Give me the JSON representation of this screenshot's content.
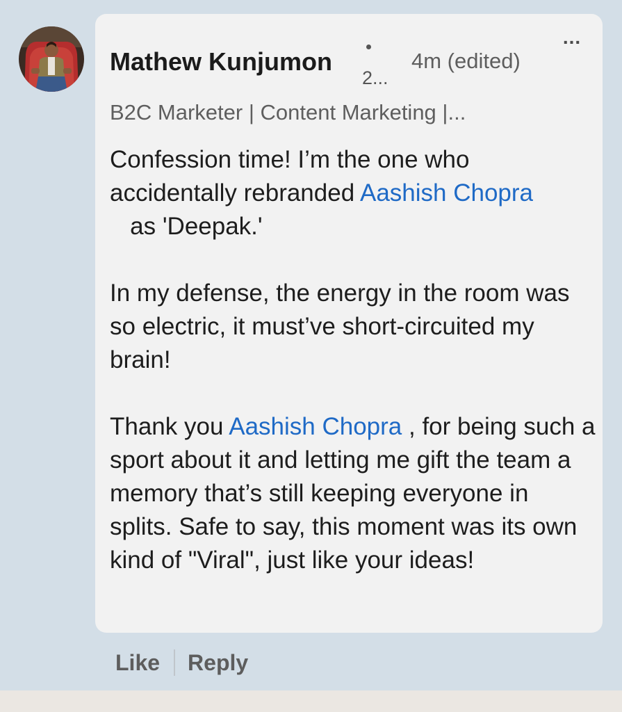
{
  "comment": {
    "author": {
      "name": "Mathew Kunjumon",
      "degree": "2...",
      "headline": "B2C Marketer | Content Marketing |..."
    },
    "timestamp": "4m (edited)",
    "more_label": "...",
    "body": {
      "p1_a": "Confession time! I’m the one who accidentally rebranded ",
      "p1_mention": "Aashish Chopra",
      "p1_b": "   as 'Deepak.'",
      "p2": "In my defense, the energy in the room was so electric, it must’ve short-circuited my brain!",
      "p3_a": "Thank you ",
      "p3_mention": "Aashish Chopra",
      "p3_b": " , for being such a sport about it and letting me gift the team a memory that’s still keeping everyone in splits. Safe to say, this moment was its own kind of \"Viral\", just like your ideas!"
    },
    "actions": {
      "like": "Like",
      "reply": "Reply"
    }
  },
  "colors": {
    "background": "#d3dee7",
    "card": "#f2f2f2",
    "mention": "#1f6ac6",
    "muted_text": "#5e5e5e"
  }
}
